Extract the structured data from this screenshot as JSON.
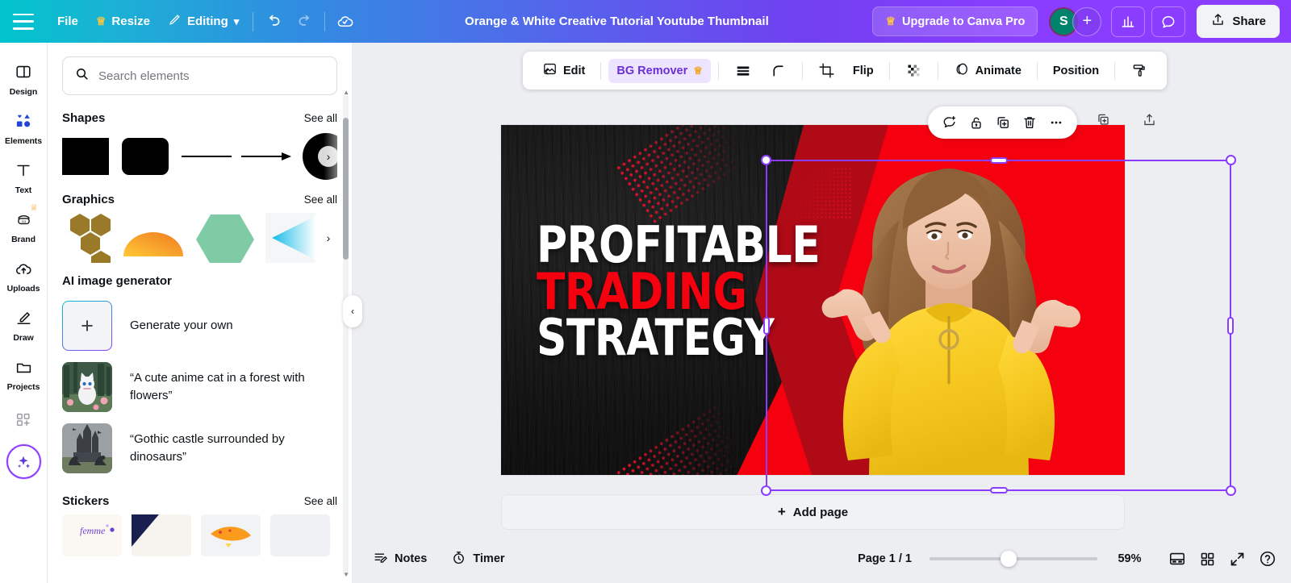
{
  "topbar": {
    "menu_icon": "hamburger-icon",
    "file_label": "File",
    "resize_label": "Resize",
    "resize_icon": "crown-icon",
    "editing_label": "Editing",
    "editing_caret": "⌄",
    "undo_icon": "undo-icon",
    "redo_icon": "redo-icon",
    "cloud_icon": "cloud-saved-icon",
    "doc_title": "Orange & White Creative Tutorial Youtube Thumbnail",
    "upgrade_label": "Upgrade to Canva Pro",
    "upgrade_icon": "crown-icon",
    "avatar_initial": "S",
    "add_member_label": "+",
    "insights_icon": "bar-chart-icon",
    "comments_icon": "comment-icon",
    "share_label": "Share",
    "share_icon": "upload-icon"
  },
  "rail": {
    "items": [
      {
        "label": "Design",
        "icon": "layout-icon",
        "active": false,
        "pro": false
      },
      {
        "label": "Elements",
        "icon": "shapes-icon",
        "active": true,
        "pro": false
      },
      {
        "label": "Text",
        "icon": "text-t-icon",
        "active": false,
        "pro": false
      },
      {
        "label": "Brand",
        "icon": "brand-icon",
        "active": false,
        "pro": true
      },
      {
        "label": "Uploads",
        "icon": "cloud-upload-icon",
        "active": false,
        "pro": false
      },
      {
        "label": "Draw",
        "icon": "pen-icon",
        "active": false,
        "pro": false
      },
      {
        "label": "Projects",
        "icon": "folder-icon",
        "active": false,
        "pro": false
      }
    ],
    "apps_icon": "apps-grid-icon",
    "magic_icon": "magic-sparkle-icon"
  },
  "panel": {
    "search": {
      "placeholder": "Search elements",
      "value": "",
      "icon": "search-icon"
    },
    "see_all_label": "See all",
    "sections": [
      {
        "title": "Shapes",
        "has_see_all": true
      },
      {
        "title": "Graphics",
        "has_see_all": true
      },
      {
        "title": "AI image generator",
        "has_see_all": false
      },
      {
        "title": "Stickers",
        "has_see_all": true
      }
    ],
    "shapes": [
      "square",
      "rounded-square",
      "line",
      "arrow",
      "gradient-circle"
    ],
    "graphics": [
      "gold-hexagons",
      "orange-semicircle",
      "green-hexagon",
      "cyan-chevron"
    ],
    "ai_items": [
      {
        "label": "Generate your own",
        "thumb": "plus-placeholder"
      },
      {
        "label": "“A cute anime cat in a forest with flowers”",
        "thumb": "anime-cat-thumb"
      },
      {
        "label": "“Gothic castle surrounded by dinosaurs”",
        "thumb": "gothic-castle-thumb"
      }
    ],
    "stickers": [
      "femme-sticker",
      "navy-shape-sticker",
      "orange-fish-sticker",
      "light-sticker"
    ],
    "collapse_icon": "chevron-left-icon",
    "next_icon": "chevron-right-icon"
  },
  "toolbar": {
    "edit_label": "Edit",
    "edit_icon": "image-edit-icon",
    "bg_remover_label": "BG Remover",
    "bg_remover_icon": "crown-icon",
    "layers_icon": "layers-icon",
    "corner_icon": "corner-radius-icon",
    "crop_icon": "crop-icon",
    "flip_label": "Flip",
    "transparency_icon": "transparency-icon",
    "animate_label": "Animate",
    "animate_icon": "animate-icon",
    "position_label": "Position",
    "paint_roller_icon": "paint-roller-icon"
  },
  "context_toolbar": {
    "comment_icon": "add-comment-icon",
    "lock_icon": "unlock-icon",
    "duplicate_icon": "duplicate-icon",
    "delete_icon": "trash-icon",
    "more_icon": "more-dots-icon",
    "ghost_lock_icon": "lock-icon",
    "ghost_duplicate_icon": "duplicate-icon",
    "ghost_export_icon": "export-icon"
  },
  "canvas": {
    "headline_line1": "PROFITABLE",
    "headline_line2": "TRADING",
    "headline_line3": "STRATEGY",
    "line1_color": "#ffffff",
    "line2_color": "#f4000f",
    "line3_color": "#ffffff",
    "background_color": "#131313",
    "accent_color": "#f4000f",
    "subject": "woman-in-yellow-sweater-pointing-down",
    "add_page_label": "Add page",
    "add_page_icon": "plus-icon",
    "rotate_icon": "rotate-icon",
    "selection_color": "#8b3dff"
  },
  "bottombar": {
    "notes_label": "Notes",
    "notes_icon": "notes-icon",
    "timer_label": "Timer",
    "timer_icon": "timer-icon",
    "page_indicator": "Page 1 / 1",
    "zoom_value": "59%",
    "presenter_icon": "presenter-view-icon",
    "grid_icon": "grid-view-icon",
    "fullscreen_icon": "fullscreen-icon",
    "help_icon": "help-icon"
  }
}
